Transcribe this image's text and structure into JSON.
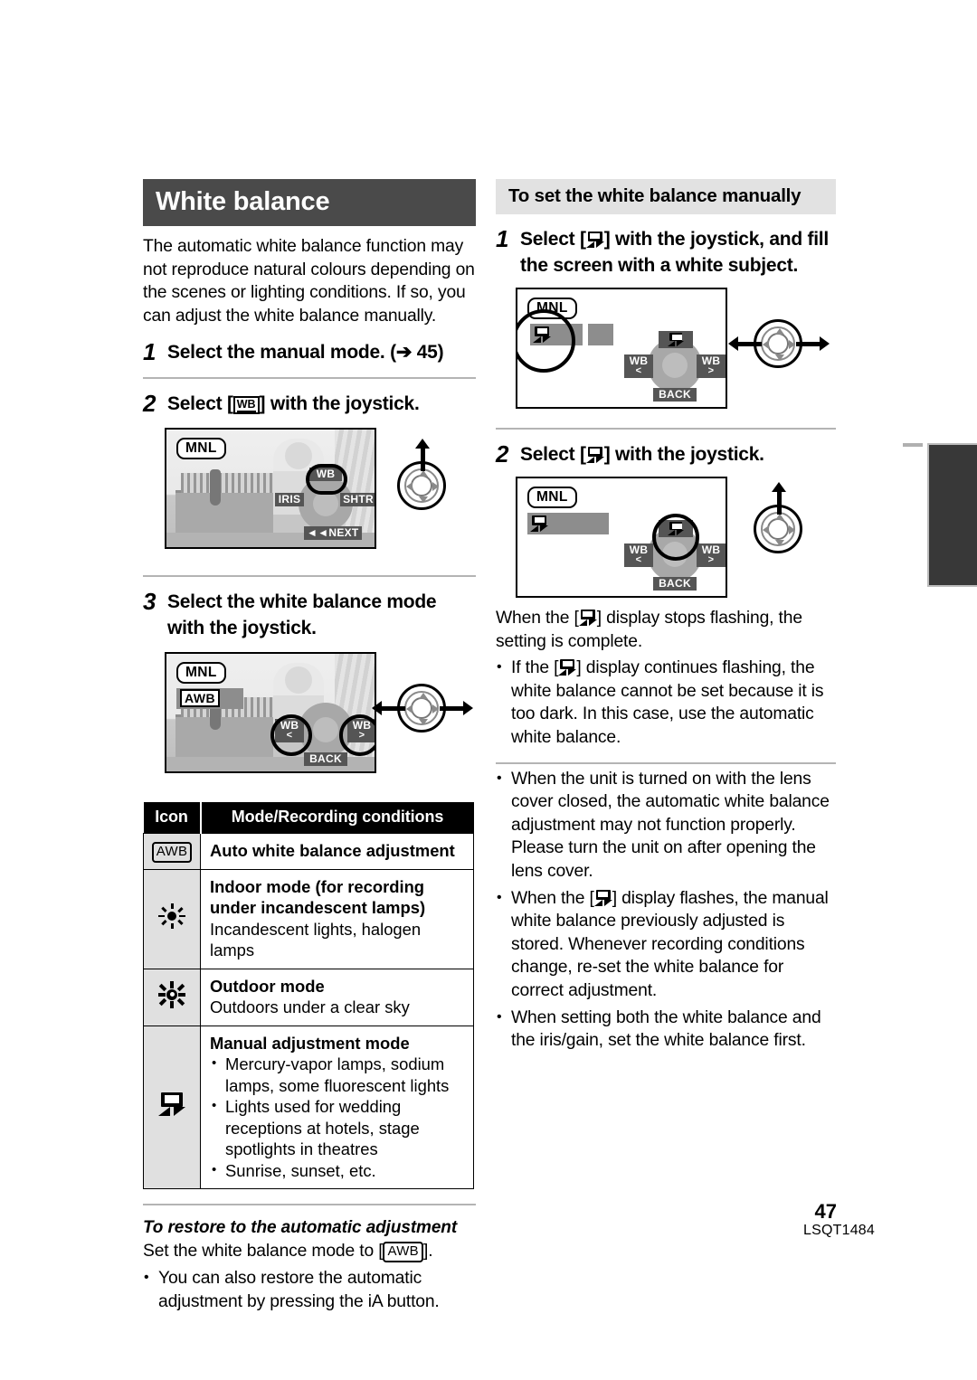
{
  "document": {
    "page_number": "47",
    "doc_id": "LSQT1484"
  },
  "left_column": {
    "section_title": "White balance",
    "intro": "The automatic white balance function may not reproduce natural colours depending on the scenes or lighting conditions. If so, you can adjust the white balance manually.",
    "step1": {
      "num": "1",
      "text": "Select the manual mode. (➔ 45)"
    },
    "step2": {
      "num": "2",
      "text_before": "Select [",
      "icon": "wb-icon",
      "text_after": "] with the joystick."
    },
    "step3": {
      "num": "3",
      "text": "Select the white balance mode with the joystick."
    },
    "screen1": {
      "badge": "MNL",
      "joystick_keys": {
        "up": "WB",
        "left": "IRIS",
        "right": "SHTR",
        "down": "NEXT"
      },
      "down_prefix": "◄◄",
      "highlight": "up"
    },
    "screen2": {
      "badge": "MNL",
      "mode_value": "AWB",
      "joystick_keys": {
        "left": "WB",
        "left_sub": "<",
        "right": "WB",
        "right_sub": ">",
        "down": "BACK"
      },
      "highlight": "left-right"
    },
    "table": {
      "headers": {
        "icon": "Icon",
        "desc": "Mode/Recording conditions"
      },
      "rows": [
        {
          "icon": "awb-icon",
          "icon_label": "AWB",
          "title": "Auto white balance adjustment",
          "sub": "",
          "bullets": []
        },
        {
          "icon": "indoor-lamp-icon",
          "icon_label": "",
          "title": "Indoor mode (for recording under incandescent lamps)",
          "sub": "Incandescent lights, halogen lamps",
          "bullets": []
        },
        {
          "icon": "outdoor-sun-icon",
          "icon_label": "",
          "title": "Outdoor mode",
          "sub": "Outdoors under a clear sky",
          "bullets": []
        },
        {
          "icon": "manual-wb-icon",
          "icon_label": "",
          "title": "Manual adjustment mode",
          "sub": "",
          "bullets": [
            "Mercury-vapor lamps, sodium lamps, some fluorescent lights",
            "Lights used for wedding receptions at hotels, stage spotlights in theatres",
            "Sunrise, sunset, etc."
          ]
        }
      ]
    },
    "restore": {
      "heading": "To restore to the automatic adjustment",
      "line_before": "Set the white balance mode to [",
      "icon_label": "AWB",
      "line_after": "].",
      "bullet": "You can also restore the automatic adjustment by pressing the iA button."
    }
  },
  "right_column": {
    "subsection_title": "To set the white balance manually",
    "step1": {
      "num": "1",
      "text_before": "Select [",
      "icon": "manual-wb-icon",
      "text_after": "] with the joystick, and fill the screen with a white subject."
    },
    "step2": {
      "num": "2",
      "text_before": "Select [",
      "icon": "manual-wb-icon",
      "text_after": "] with the joystick."
    },
    "screen1": {
      "badge": "MNL",
      "joystick_keys": {
        "up": "manual-wb-icon",
        "left": "WB",
        "left_sub": "<",
        "right": "WB",
        "right_sub": ">",
        "down": "BACK"
      },
      "highlight": "status-bar"
    },
    "screen2": {
      "badge": "MNL",
      "joystick_keys": {
        "up": "manual-wb-icon",
        "left": "WB",
        "left_sub": "<",
        "right": "WB",
        "right_sub": ">",
        "down": "BACK"
      },
      "highlight": "up-key"
    },
    "note_main_before": "When the [",
    "note_main_after": "] display stops flashing, the setting is complete.",
    "note_bullet1_before": "If the [",
    "note_bullet1_after": "] display continues flashing, the white balance cannot be set because it is too dark. In this case, use the automatic white balance.",
    "note_bullet2": "When the unit is turned on with the lens cover closed, the automatic white balance adjustment may not function properly. Please turn the unit on after opening the lens cover.",
    "note_bullet3_before": "When the [",
    "note_bullet3_after": "] display flashes, the manual white balance previously adjusted is stored. Whenever recording conditions change, re-set the white balance for correct adjustment.",
    "note_bullet4": "When setting both the white balance and the iris/gain, set the white balance first."
  }
}
